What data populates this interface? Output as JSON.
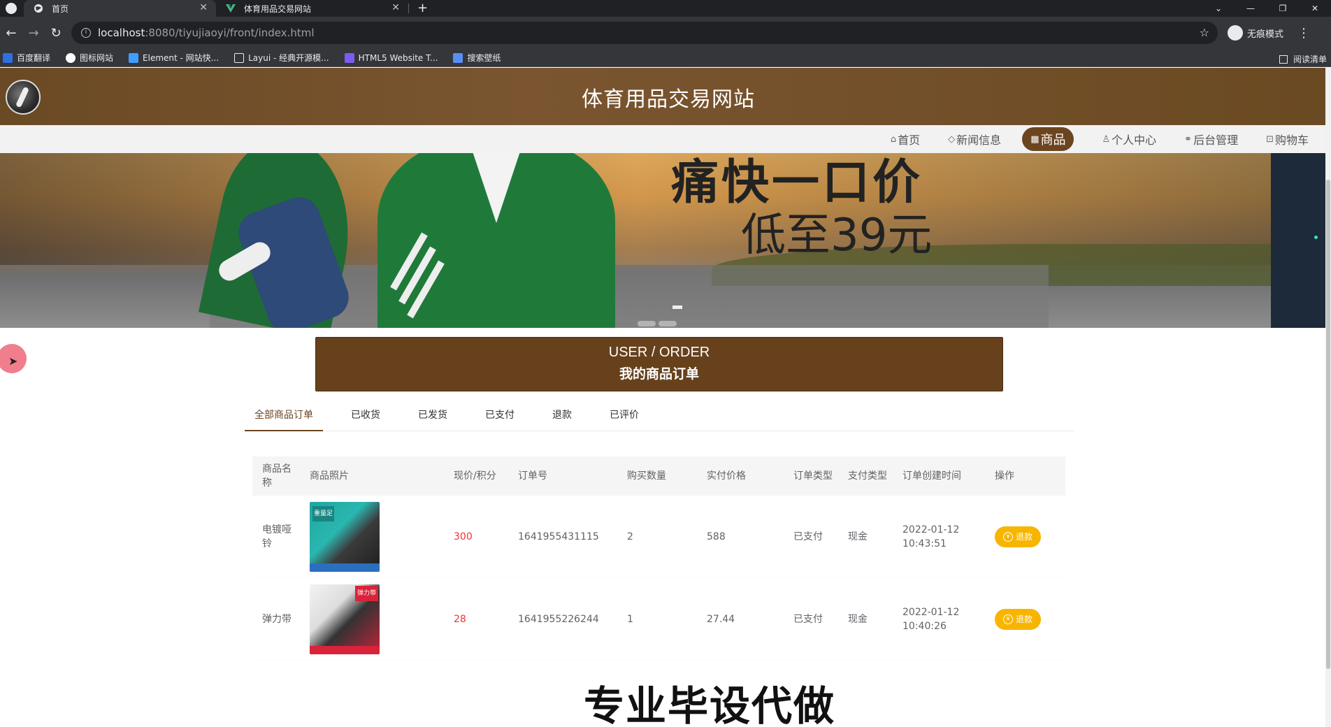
{
  "browser": {
    "tabs": [
      {
        "title": "首页",
        "active": true
      },
      {
        "title": "体育用品交易网站",
        "active": false
      }
    ],
    "url_host": "localhost",
    "url_path": ":8080/tiyujiaoyi/front/index.html",
    "profile_label": "无痕模式",
    "bookmarks": [
      "百度翻译",
      "图标网站",
      "Element - 网站快...",
      "Layui - 经典开源模...",
      "HTML5 Website T...",
      "搜索壁纸"
    ],
    "reading_list": "阅读清单"
  },
  "site": {
    "title": "体育用品交易网站",
    "nav": [
      "首页",
      "新闻信息",
      "商品",
      "个人中心",
      "后台管理",
      "购物车"
    ],
    "active_nav": "商品"
  },
  "banner": {
    "headline": "痛快一口价",
    "subline": "低至39元"
  },
  "section": {
    "title_en": "USER / ORDER",
    "title_cn": "我的商品订单"
  },
  "order_tabs": [
    "全部商品订单",
    "已收货",
    "已发货",
    "已支付",
    "退款",
    "已评价"
  ],
  "active_tab": "全部商品订单",
  "table": {
    "headers": [
      "商品名称",
      "商品照片",
      "现价/积分",
      "订单号",
      "购买数量",
      "实付价格",
      "订单类型",
      "支付类型",
      "订单创建时间",
      "操作"
    ],
    "rows": [
      {
        "name": "电镀哑铃",
        "photo": "dumbbell",
        "price": "300",
        "order_no": "1641955431115",
        "qty": "2",
        "paid": "588",
        "order_type": "已支付",
        "pay_type": "现金",
        "created": "2022-01-12 10:43:51",
        "action": "退款"
      },
      {
        "name": "弹力带",
        "photo": "band",
        "price": "28",
        "order_no": "1641955226244",
        "qty": "1",
        "paid": "27.44",
        "order_type": "已支付",
        "pay_type": "现金",
        "created": "2022-01-12 10:40:26",
        "action": "退款"
      }
    ]
  },
  "overlay_text": "专业毕设代做",
  "colors": {
    "brand_brown": "#66411c",
    "price_red": "#e33",
    "refund_yellow": "#f7b500"
  }
}
